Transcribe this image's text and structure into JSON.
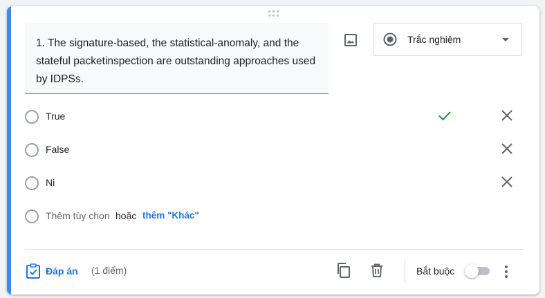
{
  "question": {
    "text": "1. The signature-based, the statistical-anomaly, and the stateful packetinspection are outstanding approaches used by IDPSs."
  },
  "question_type": {
    "selected": "Trắc nghiệm",
    "icon": "radio-button-icon"
  },
  "options": [
    {
      "label": "True",
      "is_correct": true
    },
    {
      "label": "False",
      "is_correct": false
    },
    {
      "label": "Ni",
      "is_correct": false
    }
  ],
  "add_option": {
    "label": "Thêm tùy chọn",
    "or": "hoặc",
    "add_other": "thêm \"Khác\""
  },
  "footer": {
    "answer_key_label": "Đáp án",
    "points": "(1 điểm)",
    "required_label": "Bắt buộc",
    "required_on": false
  },
  "colors": {
    "accent": "#4285f4",
    "link": "#1a73e8",
    "check": "#1e8e3e"
  }
}
